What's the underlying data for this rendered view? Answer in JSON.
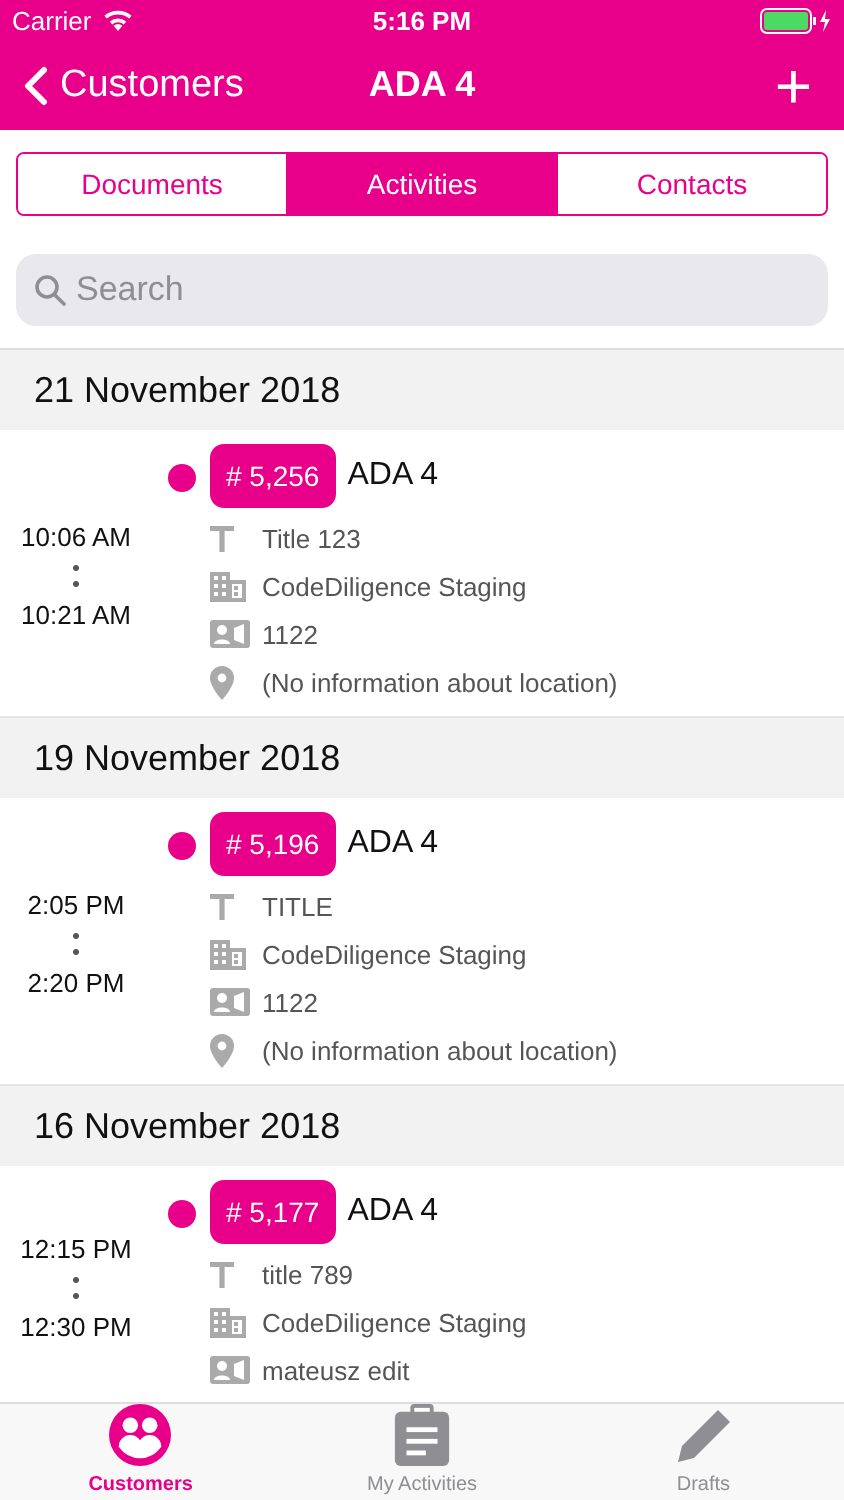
{
  "status_bar": {
    "carrier": "Carrier",
    "time": "5:16 PM"
  },
  "nav": {
    "back": "Customers",
    "title": "ADA 4",
    "add": "+"
  },
  "segments": [
    {
      "label": "Documents",
      "selected": false
    },
    {
      "label": "Activities",
      "selected": true
    },
    {
      "label": "Contacts",
      "selected": false
    }
  ],
  "search": {
    "placeholder": "Search"
  },
  "sections": [
    {
      "date": "21 November 2018",
      "activities": [
        {
          "start": "10:06 AM",
          "end": "10:21 AM",
          "number": "# 5,256",
          "name": "ADA 4",
          "details": [
            {
              "kind": "title",
              "text": "Title 123"
            },
            {
              "kind": "company",
              "text": "CodeDiligence Staging"
            },
            {
              "kind": "contact",
              "text": "1122"
            },
            {
              "kind": "location",
              "text": "(No information about location)"
            }
          ]
        }
      ]
    },
    {
      "date": "19 November 2018",
      "activities": [
        {
          "start": "2:05 PM",
          "end": "2:20 PM",
          "number": "# 5,196",
          "name": "ADA 4",
          "details": [
            {
              "kind": "title",
              "text": "TITLE"
            },
            {
              "kind": "company",
              "text": "CodeDiligence Staging"
            },
            {
              "kind": "contact",
              "text": "1122"
            },
            {
              "kind": "location",
              "text": "(No information about location)"
            }
          ]
        }
      ]
    },
    {
      "date": "16 November 2018",
      "activities": [
        {
          "start": "12:15 PM",
          "end": "12:30 PM",
          "number": "# 5,177",
          "name": "ADA 4",
          "details": [
            {
              "kind": "title",
              "text": "title 789"
            },
            {
              "kind": "company",
              "text": "CodeDiligence Staging"
            },
            {
              "kind": "contact",
              "text": "mateusz edit"
            }
          ]
        }
      ]
    }
  ],
  "tab_bar": [
    {
      "kind": "customers",
      "label": "Customers",
      "selected": true
    },
    {
      "kind": "activities",
      "label": "My Activities",
      "selected": false
    },
    {
      "kind": "drafts",
      "label": "Drafts",
      "selected": false
    }
  ]
}
